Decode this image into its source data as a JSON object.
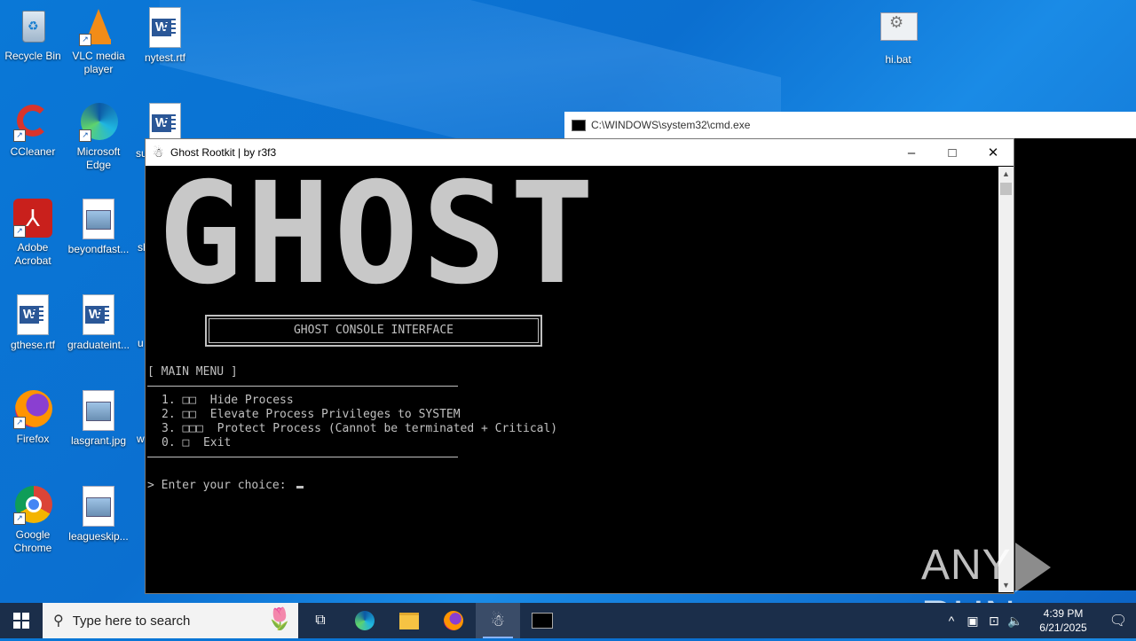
{
  "desktop": {
    "icons": [
      {
        "label": "Recycle Bin",
        "icon": "recycle-bin-icon"
      },
      {
        "label": "VLC media player",
        "icon": "vlc-icon"
      },
      {
        "label": "nytest.rtf",
        "icon": "word-doc-icon"
      },
      {
        "label": "hi.bat",
        "icon": "batch-file-icon"
      },
      {
        "label": "CCleaner",
        "icon": "ccleaner-icon"
      },
      {
        "label": "Microsoft Edge",
        "icon": "edge-icon"
      },
      {
        "label": "su",
        "icon": "word-doc-icon"
      },
      {
        "label": "Adobe Acrobat",
        "icon": "acrobat-icon"
      },
      {
        "label": "beyondfast...",
        "icon": "image-file-icon"
      },
      {
        "label": "sh",
        "icon": "image-file-icon"
      },
      {
        "label": "gthese.rtf",
        "icon": "word-doc-icon"
      },
      {
        "label": "graduateint...",
        "icon": "word-doc-icon"
      },
      {
        "label": "u",
        "icon": "word-doc-icon"
      },
      {
        "label": "Firefox",
        "icon": "firefox-icon"
      },
      {
        "label": "lasgrant.jpg",
        "icon": "image-file-icon"
      },
      {
        "label": "w",
        "icon": "word-doc-icon"
      },
      {
        "label": "Google Chrome",
        "icon": "chrome-icon"
      },
      {
        "label": "leagueskip...",
        "icon": "image-file-icon"
      }
    ]
  },
  "cmd_window": {
    "title": "C:\\WINDOWS\\system32\\cmd.exe"
  },
  "ghost_window": {
    "title": "Ghost Rootkit | by r3f3",
    "banner": "GHOST",
    "box_title": "GHOST CONSOLE INTERFACE",
    "menu_header": "[ MAIN MENU ]",
    "menu_items": [
      "1. □□  Hide Process",
      "2. □□  Elevate Process Privileges to SYSTEM",
      "3. □□□  Protect Process (Cannot be terminated + Critical)",
      "0. □  Exit"
    ],
    "prompt": "> Enter your choice: "
  },
  "watermark": {
    "left": "ANY",
    "right": "RUN"
  },
  "taskbar": {
    "search_placeholder": "Type here to search",
    "time": "4:39 PM",
    "date": "6/21/2025"
  }
}
